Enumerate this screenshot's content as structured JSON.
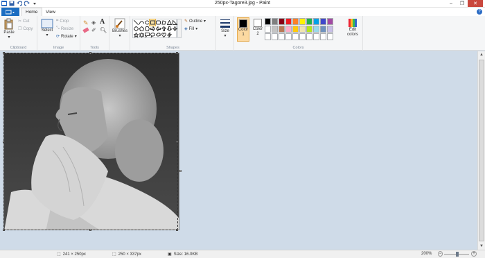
{
  "window": {
    "title": "250px-Tagore3.jpg - Paint"
  },
  "tabs": {
    "file": "",
    "home": "Home",
    "view": "View"
  },
  "clipboard": {
    "paste": "Paste",
    "cut": "Cut",
    "copy": "Copy",
    "label": "Clipboard"
  },
  "image": {
    "select": "Select",
    "crop": "Crop",
    "resize": "Resize",
    "rotate": "Rotate",
    "label": "Image"
  },
  "tools": {
    "label": "Tools",
    "text_tool": "A"
  },
  "brushes": {
    "label": "Brushes"
  },
  "shapes": {
    "label": "Shapes",
    "outline": "Outline",
    "fill": "Fill"
  },
  "size": {
    "label": "Size"
  },
  "colors": {
    "color1": "Color\n1",
    "color2": "Color\n2",
    "edit": "Edit colors",
    "label": "Colors",
    "color1_value": "#000000",
    "color2_value": "#ffffff",
    "palette": [
      "#000000",
      "#7f7f7f",
      "#880015",
      "#ed1c24",
      "#ff7f27",
      "#fff200",
      "#22b14c",
      "#00a2e8",
      "#3f48cc",
      "#a349a4",
      "#ffffff",
      "#c3c3c3",
      "#b97a57",
      "#ffaec9",
      "#ffc90e",
      "#efe4b0",
      "#b5e61d",
      "#99d9ea",
      "#7092be",
      "#c8bfe7",
      "#ffffff",
      "#ffffff",
      "#ffffff",
      "#ffffff",
      "#ffffff",
      "#ffffff",
      "#ffffff",
      "#ffffff",
      "#ffffff",
      "#ffffff"
    ]
  },
  "status": {
    "selection_size": "241 × 250px",
    "image_size": "250 × 337px",
    "file_size": "Size: 16.0KB",
    "zoom": "200%"
  }
}
